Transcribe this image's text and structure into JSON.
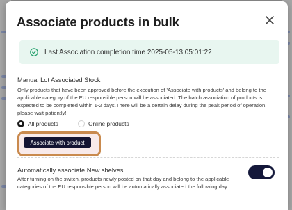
{
  "modal": {
    "title": "Associate products in bulk",
    "close_icon": "close-icon"
  },
  "banner": {
    "icon": "check-circle-icon",
    "text": "Last Association completion time 2025-05-13 05:01:22",
    "accent_color": "#22a06b"
  },
  "manual": {
    "title": "Manual Lot Associated Stock",
    "description": "Only products that have been approved before the execution of 'Associate with products' and belong to the applicable category of the EU responsible person will be associated. The batch association of products is expected to be completed within 1-2 days.There will be a certain delay during the peak period of operation, please wait patiently!",
    "options": [
      {
        "label": "All products",
        "selected": true
      },
      {
        "label": "Online products",
        "selected": false
      }
    ],
    "button_label": "Associate with product"
  },
  "auto": {
    "title": "Automatically associate New shelves",
    "description": "After turning on the switch, products newly posted on that day and belong to the applicable categories of the EU responsible person will be automatically associated the following day.",
    "toggle_on": true
  },
  "colors": {
    "primary_dark": "#141432",
    "highlight_border": "#c98a4e"
  }
}
